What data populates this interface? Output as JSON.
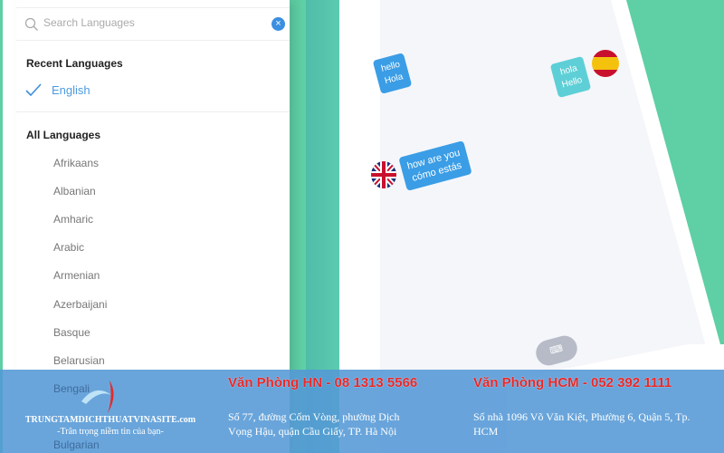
{
  "search": {
    "placeholder": "Search Languages"
  },
  "recent": {
    "title": "Recent Languages",
    "items": [
      "English"
    ]
  },
  "all": {
    "title": "All Languages",
    "items": [
      "Afrikaans",
      "Albanian",
      "Amharic",
      "Arabic",
      "Armenian",
      "Azerbaijani",
      "Basque",
      "Belarusian",
      "Bengali",
      "Bulgarian"
    ]
  },
  "chat": [
    {
      "line1": "hello",
      "line2": "Hola",
      "color": "#3a9de6"
    },
    {
      "line1": "hola",
      "line2": "Hello",
      "color": "#5ecfd6"
    },
    {
      "line1": "how are you",
      "line2": "cómo estás",
      "color": "#3a9de6"
    }
  ],
  "keyboard_icon": "keyboard-icon",
  "footer": {
    "brand": "TRUNGTAMDICHTHUATVINASITE.com",
    "slogan": "-Trân trọng niềm tin của bạn-",
    "hn_title": "Văn Phòng HN - 08 1313 5566",
    "hn_address": "Số 77, đường Cốm Vòng, phường Dịch Vọng Hậu, quận Cầu Giấy, TP. Hà Nội",
    "hcm_title": "Văn Phòng HCM - 052 392 1111",
    "hcm_address": "Số nhà 1096 Võ Văn Kiệt, Phường 6, Quận 5, Tp. HCM"
  }
}
